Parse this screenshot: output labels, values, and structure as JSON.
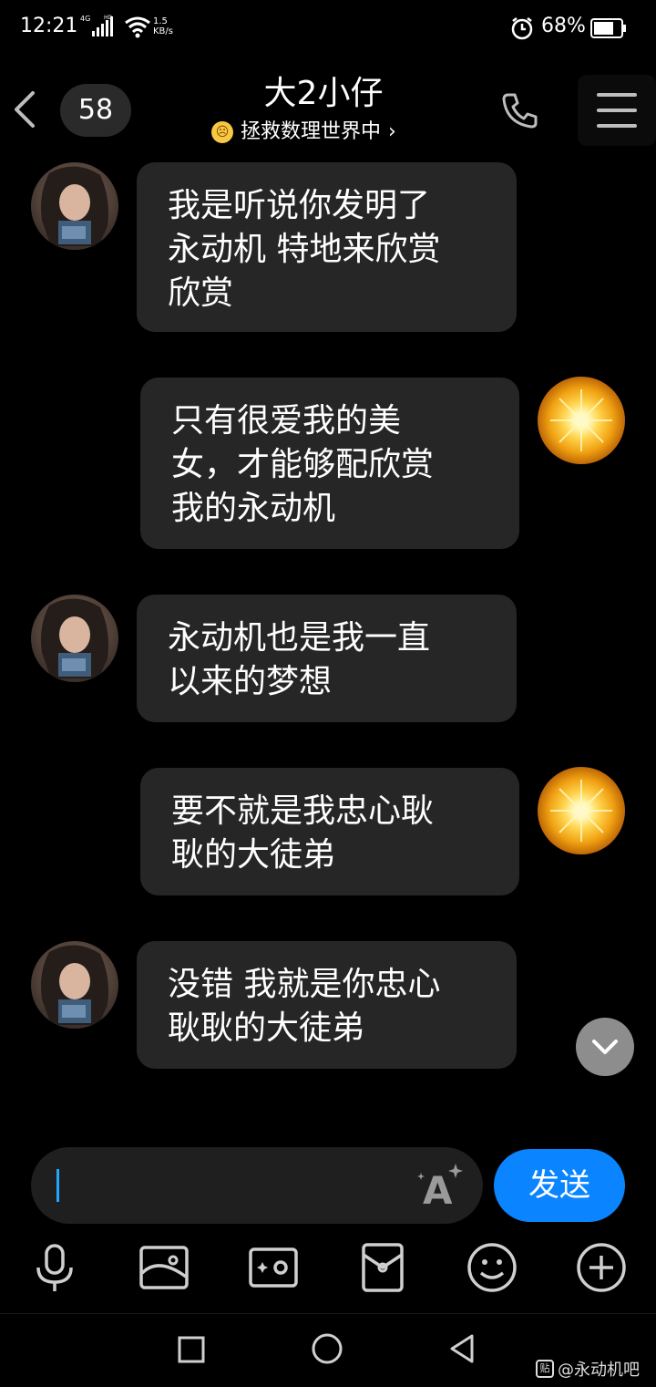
{
  "status_bar": {
    "time": "12:21",
    "network": "4G",
    "hd": "HD",
    "speed_value": "1.5",
    "speed_unit": "KB/s",
    "battery_percent": "68%"
  },
  "header": {
    "unread_count": "58",
    "title": "大2小仔",
    "subtitle": "拯救数理世界中",
    "subtitle_chevron": "›"
  },
  "messages": [
    {
      "side": "left",
      "text_lines": [
        "我是听说你发明了",
        "永动机 特地来欣赏",
        "欣赏"
      ]
    },
    {
      "side": "right",
      "text_lines": [
        "只有很爱我的美",
        "女，才能够配欣赏",
        "我的永动机"
      ]
    },
    {
      "side": "left",
      "text_lines": [
        "永动机也是我一直",
        "以来的梦想"
      ]
    },
    {
      "side": "right",
      "text_lines": [
        "要不就是我忠心耿",
        "耿的大徒弟"
      ]
    },
    {
      "side": "left",
      "text_lines": [
        "没错 我就是你忠心",
        "耿耿的大徒弟"
      ]
    }
  ],
  "input": {
    "value": "",
    "send_label": "发送"
  },
  "toolbar": {
    "icons": [
      "microphone-icon",
      "image-icon",
      "camera-icon",
      "red-envelope-icon",
      "emoji-icon",
      "plus-icon"
    ]
  },
  "navigation": {
    "icons": [
      "recent-apps-icon",
      "home-icon",
      "back-icon"
    ]
  },
  "watermark": {
    "text": "@永动机吧",
    "icon_text": "贴"
  },
  "colors": {
    "background": "#000000",
    "bubble": "#262626",
    "send_button": "#0a84ff",
    "cursor": "#22a6ff"
  }
}
